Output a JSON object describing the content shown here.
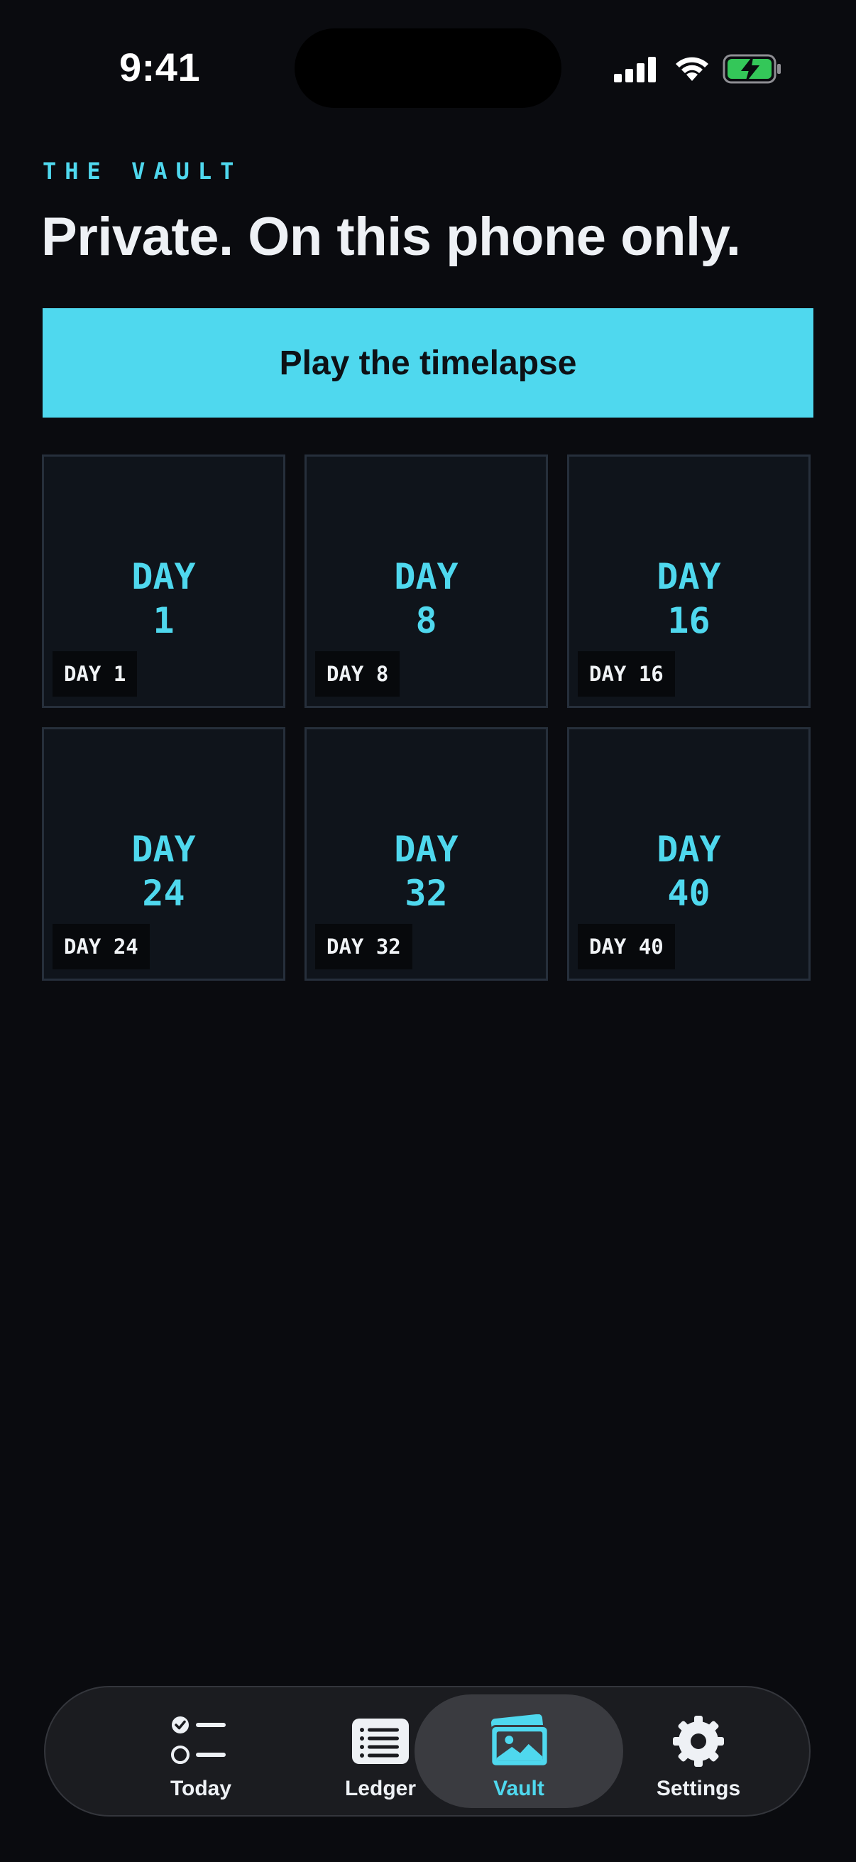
{
  "status_bar": {
    "time": "9:41"
  },
  "header": {
    "eyebrow": "THE VAULT",
    "title": "Private. On this phone only."
  },
  "play_button": {
    "label": "Play the timelapse"
  },
  "grid": {
    "tiles": [
      {
        "line1": "DAY",
        "line2": "1",
        "tag": "DAY 1"
      },
      {
        "line1": "DAY",
        "line2": "8",
        "tag": "DAY 8"
      },
      {
        "line1": "DAY",
        "line2": "16",
        "tag": "DAY 16"
      },
      {
        "line1": "DAY",
        "line2": "24",
        "tag": "DAY 24"
      },
      {
        "line1": "DAY",
        "line2": "32",
        "tag": "DAY 32"
      },
      {
        "line1": "DAY",
        "line2": "40",
        "tag": "DAY 40"
      }
    ]
  },
  "tab_bar": {
    "tabs": [
      {
        "label": "Today",
        "icon": "checklist-icon",
        "active": false
      },
      {
        "label": "Ledger",
        "icon": "list-icon",
        "active": false
      },
      {
        "label": "Vault",
        "icon": "photos-icon",
        "active": true
      },
      {
        "label": "Settings",
        "icon": "gear-icon",
        "active": false
      }
    ]
  },
  "colors": {
    "accent": "#4fd8ee",
    "background": "#0a0b0f",
    "tile_background": "#0f141b",
    "battery": "#34c759"
  }
}
